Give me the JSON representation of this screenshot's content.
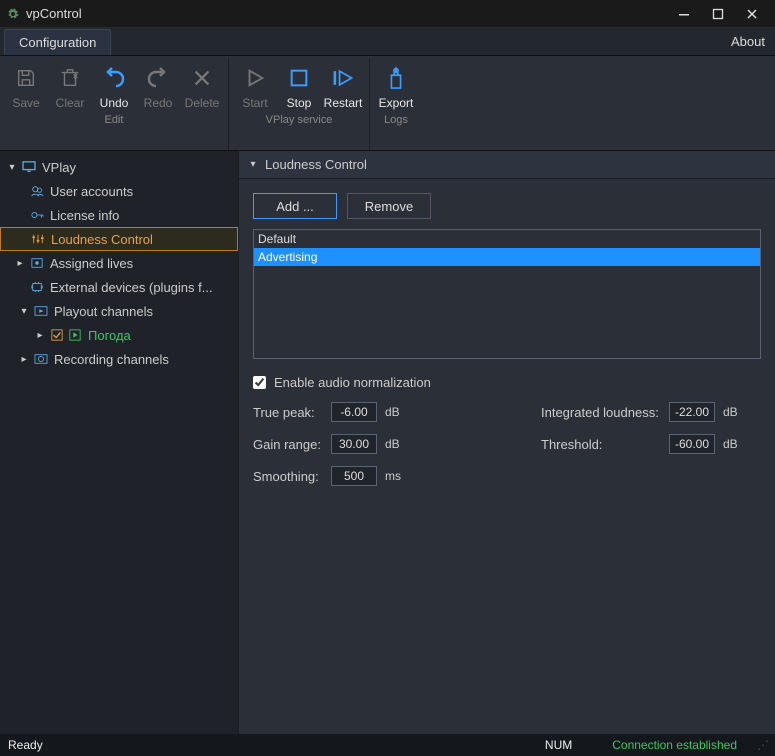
{
  "window": {
    "title": "vpControl"
  },
  "menu": {
    "config_tab": "Configuration",
    "about": "About"
  },
  "ribbon": {
    "save": "Save",
    "clear": "Clear",
    "undo": "Undo",
    "redo": "Redo",
    "delete": "Delete",
    "start": "Start",
    "stop": "Stop",
    "restart": "Restart",
    "export": "Export",
    "group_edit": "Edit",
    "group_vplay": "VPlay service",
    "group_logs": "Logs"
  },
  "tree": {
    "vplay": "VPlay",
    "user_accounts": "User accounts",
    "license_info": "License info",
    "loudness_control": "Loudness Control",
    "assigned_lives": "Assigned lives",
    "external_devices": "External devices (plugins f...",
    "playout_channels": "Playout channels",
    "pogoda": "Погода",
    "recording_channels": "Recording channels"
  },
  "pane": {
    "title": "Loudness Control",
    "add_btn": "Add ...",
    "remove_btn": "Remove",
    "list": {
      "default": "Default",
      "advertising": "Advertising"
    },
    "enable_chk": "Enable audio normalization",
    "true_peak_lbl": "True peak:",
    "gain_range_lbl": "Gain range:",
    "smoothing_lbl": "Smoothing:",
    "integrated_lbl": "Integrated loudness:",
    "threshold_lbl": "Threshold:",
    "true_peak_val": "-6.00",
    "gain_range_val": "30.00",
    "smoothing_val": "500",
    "integrated_val": "-22.00",
    "threshold_val": "-60.00",
    "unit_db": "dB",
    "unit_ms": "ms"
  },
  "status": {
    "ready": "Ready",
    "num": "NUM",
    "conn": "Connection established"
  }
}
